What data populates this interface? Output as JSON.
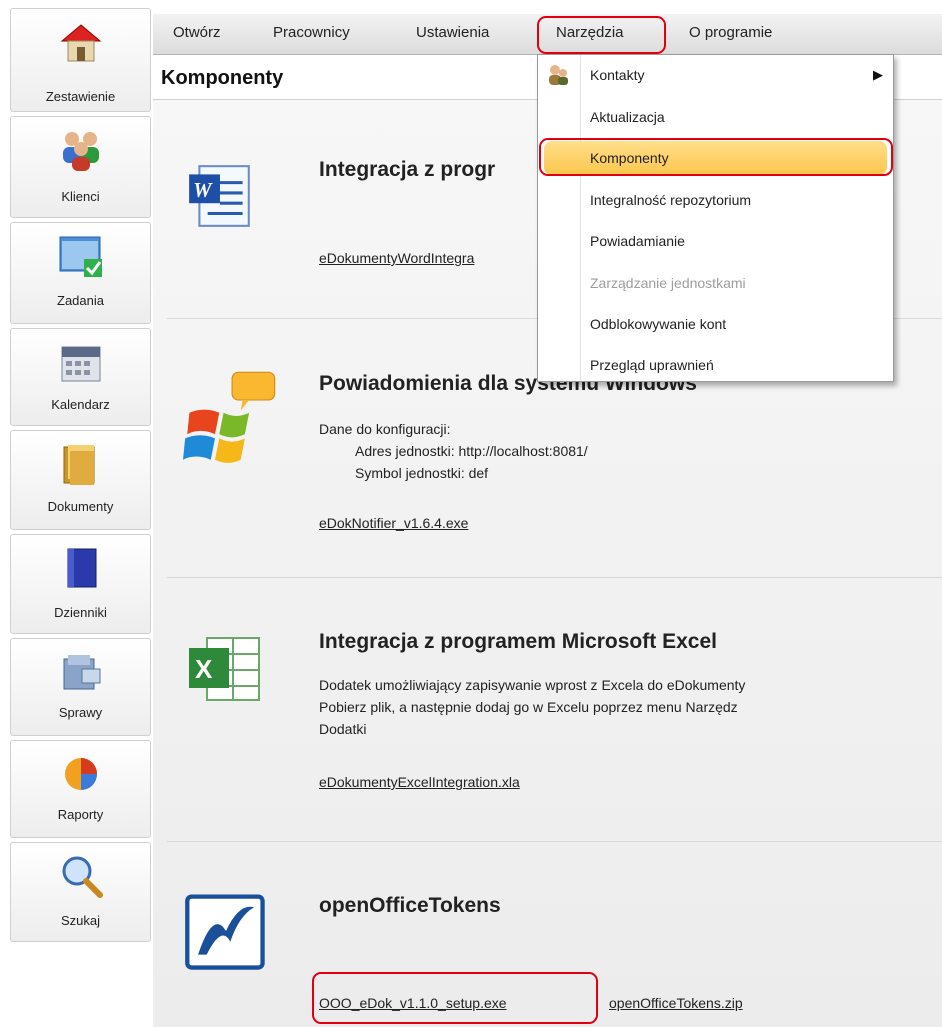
{
  "sidebar": {
    "items": [
      {
        "label": "Zestawienie",
        "icon": "house-icon"
      },
      {
        "label": "Klienci",
        "icon": "people-icon"
      },
      {
        "label": "Zadania",
        "icon": "task-check-icon"
      },
      {
        "label": "Kalendarz",
        "icon": "calendar-icon"
      },
      {
        "label": "Dokumenty",
        "icon": "folder-icon"
      },
      {
        "label": "Dzienniki",
        "icon": "journal-book-icon"
      },
      {
        "label": "Sprawy",
        "icon": "cases-icon"
      },
      {
        "label": "Raporty",
        "icon": "pie-chart-icon"
      },
      {
        "label": "Szukaj",
        "icon": "magnifier-icon"
      }
    ]
  },
  "menubar": {
    "items": [
      "Otwórz",
      "Pracownicy",
      "Ustawienia",
      "Narzędzia",
      "O programie"
    ]
  },
  "page": {
    "title": "Komponenty"
  },
  "dropdown": {
    "items": [
      {
        "label": "Kontakty",
        "has_submenu": true
      },
      {
        "label": "Aktualizacja"
      },
      {
        "label": "Komponenty",
        "highlighted": true
      },
      {
        "label": "Integralność repozytorium"
      },
      {
        "label": "Powiadamianie"
      },
      {
        "label": "Zarządzanie jednostkami",
        "disabled": true
      },
      {
        "label": "Odblokowywanie kont"
      },
      {
        "label": "Przegląd uprawnień"
      }
    ]
  },
  "sections": {
    "word": {
      "title": "Integracja z progr",
      "link": "eDokumentyWordIntegra"
    },
    "notifier": {
      "title": "Powiadomienia dla systemu Windows",
      "config_label": "Dane do konfiguracji:",
      "address": "Adres jednostki: http://localhost:8081/",
      "symbol": "Symbol jednostki: def",
      "link": "eDokNotifier_v1.6.4.exe"
    },
    "excel": {
      "title": "Integracja z programem Microsoft Excel",
      "line1": "Dodatek umożliwiający zapisywanie wprost z Excela do eDokumenty",
      "line2": "Pobierz plik, a następnie dodaj go w Excelu poprzez menu Narzędz",
      "line3": "Dodatki",
      "link": "eDokumentyExcelIntegration.xla"
    },
    "ooo": {
      "title": "openOfficeTokens",
      "link1": "OOO_eDok_v1.1.0_setup.exe",
      "link2": "openOfficeTokens.zip"
    }
  },
  "colors": {
    "highlight_red": "#e00010",
    "menu_hover": "#fcc64c"
  }
}
